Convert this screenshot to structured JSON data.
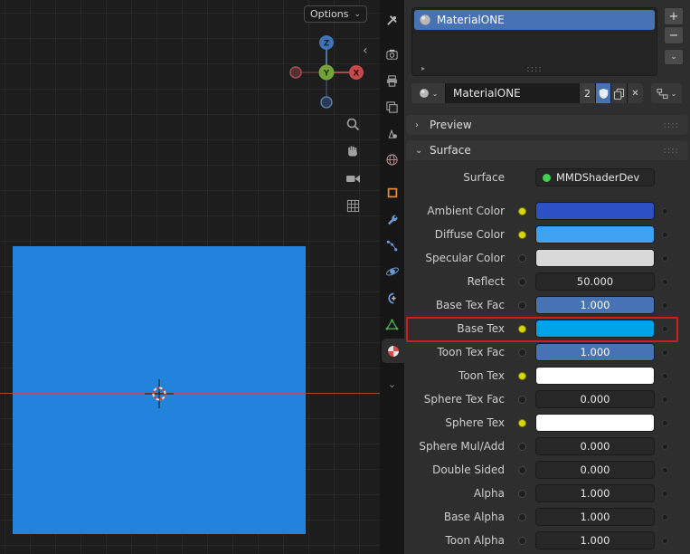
{
  "viewport": {
    "options_label": "Options",
    "axis": {
      "z": "Z",
      "y": "Y",
      "x": "X"
    }
  },
  "glyphs": {
    "chevron_down": "⌄",
    "chevron_right": "›",
    "chevron_left": "‹",
    "plus": "+",
    "minus": "−",
    "close": "✕",
    "triangle_right": "▸",
    "grip": "::::"
  },
  "slot_list": {
    "selected_material": "MaterialONE"
  },
  "datablock": {
    "name": "MaterialONE",
    "users": "2"
  },
  "panels": {
    "preview": "Preview",
    "surface": "Surface"
  },
  "surface": {
    "rows": [
      {
        "label": "Surface",
        "widget": "shader",
        "value": "MMDShaderDev",
        "dot": "none",
        "decorator": false
      },
      {
        "label": "Ambient Color",
        "widget": "color",
        "value": "#2d50c4",
        "dot": "yellow",
        "decorator": true
      },
      {
        "label": "Diffuse Color",
        "widget": "color",
        "value": "#3ea2f0",
        "dot": "yellow",
        "decorator": true
      },
      {
        "label": "Specular Color",
        "widget": "color",
        "value": "#d9d9d9",
        "dot": "gray",
        "decorator": true
      },
      {
        "label": "Reflect",
        "widget": "number",
        "value": "50.000",
        "dot": "gray",
        "decorator": true
      },
      {
        "label": "Base Tex Fac",
        "widget": "slider",
        "value": "1.000",
        "dot": "gray",
        "decorator": true
      },
      {
        "label": "Base Tex",
        "widget": "color",
        "value": "#00a3e8",
        "dot": "yellow",
        "decorator": true,
        "highlighted": true
      },
      {
        "label": "Toon Tex Fac",
        "widget": "slider",
        "value": "1.000",
        "dot": "gray",
        "decorator": true
      },
      {
        "label": "Toon Tex",
        "widget": "color",
        "value": "#ffffff",
        "dot": "yellow",
        "decorator": true
      },
      {
        "label": "Sphere Tex Fac",
        "widget": "number",
        "value": "0.000",
        "dot": "gray",
        "decorator": true
      },
      {
        "label": "Sphere Tex",
        "widget": "color",
        "value": "#ffffff",
        "dot": "yellow",
        "decorator": true
      },
      {
        "label": "Sphere Mul/Add",
        "widget": "number",
        "value": "0.000",
        "dot": "gray",
        "decorator": true
      },
      {
        "label": "Double Sided",
        "widget": "number",
        "value": "0.000",
        "dot": "gray",
        "decorator": true
      },
      {
        "label": "Alpha",
        "widget": "number",
        "value": "1.000",
        "dot": "gray",
        "decorator": true
      },
      {
        "label": "Base Alpha",
        "widget": "number",
        "value": "1.000",
        "dot": "gray",
        "decorator": true
      },
      {
        "label": "Toon Alpha",
        "widget": "number",
        "value": "1.000",
        "dot": "gray",
        "decorator": true
      }
    ]
  },
  "colors": {
    "accent": "#4772b3",
    "plane": "#2183dc",
    "highlight_outline": "#cf1d1d",
    "shader_node_dot": "#3fd14f"
  }
}
